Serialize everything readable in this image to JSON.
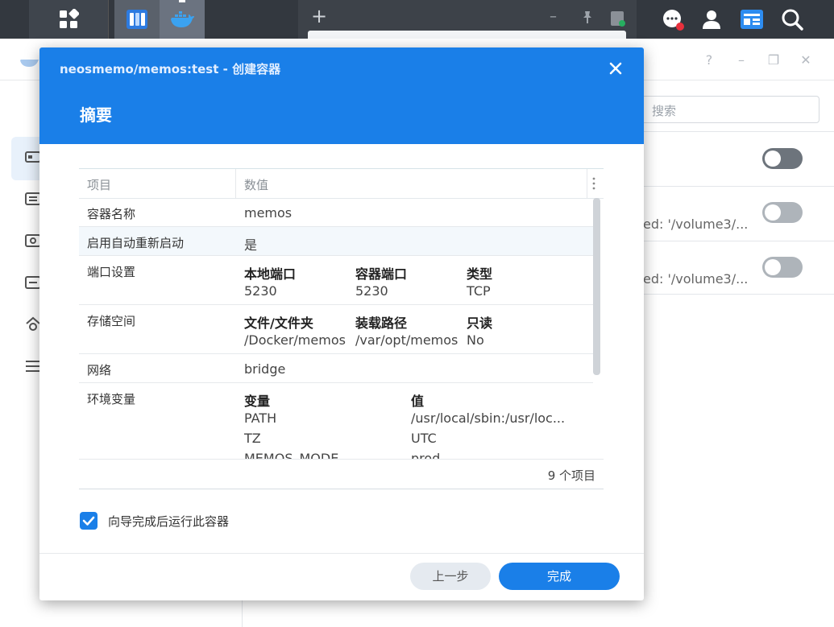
{
  "taskbar": {
    "main_menu_icon": "grid-icon",
    "apps": [
      "package-center-icon",
      "container-manager-icon"
    ],
    "browser_new_tab": "+",
    "right_icons": [
      "chat-icon",
      "user-icon",
      "widgets-icon",
      "search-icon"
    ]
  },
  "background": {
    "search_placeholder": "搜索",
    "row2_text": "ed: '/volume3/...",
    "row3_text": "ed: '/volume3/...",
    "window_controls": [
      "?",
      "–",
      "❐",
      "✕"
    ]
  },
  "modal": {
    "title": "neosmemo/memos:test - 创建容器",
    "subtitle": "摘要",
    "table": {
      "col_item": "项目",
      "col_value": "数值",
      "rows": {
        "name": {
          "label": "容器名称",
          "value": "memos"
        },
        "restart": {
          "label": "启用自动重新启动",
          "value": "是"
        },
        "ports": {
          "label": "端口设置",
          "h_local": "本地端口",
          "h_container": "容器端口",
          "h_type": "类型",
          "v_local": "5230",
          "v_container": "5230",
          "v_type": "TCP"
        },
        "storage": {
          "label": "存储空间",
          "h_folder": "文件/文件夹",
          "h_mount": "装载路径",
          "h_readonly": "只读",
          "v_folder": "/Docker/memos",
          "v_mount": "/var/opt/memos",
          "v_readonly": "No"
        },
        "network": {
          "label": "网络",
          "value": "bridge"
        },
        "env": {
          "label": "环境变量",
          "h_var": "变量",
          "h_val": "值",
          "vars": [
            {
              "name": "PATH",
              "value": "/usr/local/sbin:/usr/loc..."
            },
            {
              "name": "TZ",
              "value": "UTC"
            },
            {
              "name": "MEMOS_MODE",
              "value": "prod"
            }
          ]
        }
      },
      "footer": "9 个项目"
    },
    "checkbox_label": "向导完成后运行此容器",
    "checkbox_checked": true,
    "btn_prev": "上一步",
    "btn_done": "完成"
  },
  "colors": {
    "accent": "#1a7fe8",
    "taskbar": "#33383f"
  }
}
